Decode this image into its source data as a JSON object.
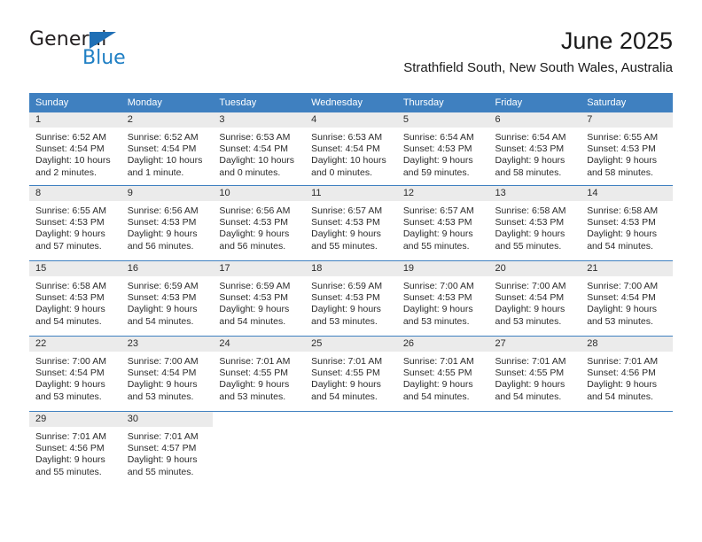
{
  "brand": {
    "name_part1": "General",
    "name_part2": "Blue",
    "accent_color": "#1f7fc4",
    "triangle_color": "#1f6fb5"
  },
  "header": {
    "title": "June 2025",
    "subtitle": "Strathfield South, New South Wales, Australia"
  },
  "calendar": {
    "header_bg": "#3f80c0",
    "daynum_bg": "#ebebeb",
    "weekday_headers": [
      "Sunday",
      "Monday",
      "Tuesday",
      "Wednesday",
      "Thursday",
      "Friday",
      "Saturday"
    ],
    "weeks": [
      {
        "days": [
          {
            "daynum": "1",
            "sunrise": "Sunrise: 6:52 AM",
            "sunset": "Sunset: 4:54 PM",
            "daylight_line1": "Daylight: 10 hours",
            "daylight_line2": "and 2 minutes."
          },
          {
            "daynum": "2",
            "sunrise": "Sunrise: 6:52 AM",
            "sunset": "Sunset: 4:54 PM",
            "daylight_line1": "Daylight: 10 hours",
            "daylight_line2": "and 1 minute."
          },
          {
            "daynum": "3",
            "sunrise": "Sunrise: 6:53 AM",
            "sunset": "Sunset: 4:54 PM",
            "daylight_line1": "Daylight: 10 hours",
            "daylight_line2": "and 0 minutes."
          },
          {
            "daynum": "4",
            "sunrise": "Sunrise: 6:53 AM",
            "sunset": "Sunset: 4:54 PM",
            "daylight_line1": "Daylight: 10 hours",
            "daylight_line2": "and 0 minutes."
          },
          {
            "daynum": "5",
            "sunrise": "Sunrise: 6:54 AM",
            "sunset": "Sunset: 4:53 PM",
            "daylight_line1": "Daylight: 9 hours",
            "daylight_line2": "and 59 minutes."
          },
          {
            "daynum": "6",
            "sunrise": "Sunrise: 6:54 AM",
            "sunset": "Sunset: 4:53 PM",
            "daylight_line1": "Daylight: 9 hours",
            "daylight_line2": "and 58 minutes."
          },
          {
            "daynum": "7",
            "sunrise": "Sunrise: 6:55 AM",
            "sunset": "Sunset: 4:53 PM",
            "daylight_line1": "Daylight: 9 hours",
            "daylight_line2": "and 58 minutes."
          }
        ]
      },
      {
        "days": [
          {
            "daynum": "8",
            "sunrise": "Sunrise: 6:55 AM",
            "sunset": "Sunset: 4:53 PM",
            "daylight_line1": "Daylight: 9 hours",
            "daylight_line2": "and 57 minutes."
          },
          {
            "daynum": "9",
            "sunrise": "Sunrise: 6:56 AM",
            "sunset": "Sunset: 4:53 PM",
            "daylight_line1": "Daylight: 9 hours",
            "daylight_line2": "and 56 minutes."
          },
          {
            "daynum": "10",
            "sunrise": "Sunrise: 6:56 AM",
            "sunset": "Sunset: 4:53 PM",
            "daylight_line1": "Daylight: 9 hours",
            "daylight_line2": "and 56 minutes."
          },
          {
            "daynum": "11",
            "sunrise": "Sunrise: 6:57 AM",
            "sunset": "Sunset: 4:53 PM",
            "daylight_line1": "Daylight: 9 hours",
            "daylight_line2": "and 55 minutes."
          },
          {
            "daynum": "12",
            "sunrise": "Sunrise: 6:57 AM",
            "sunset": "Sunset: 4:53 PM",
            "daylight_line1": "Daylight: 9 hours",
            "daylight_line2": "and 55 minutes."
          },
          {
            "daynum": "13",
            "sunrise": "Sunrise: 6:58 AM",
            "sunset": "Sunset: 4:53 PM",
            "daylight_line1": "Daylight: 9 hours",
            "daylight_line2": "and 55 minutes."
          },
          {
            "daynum": "14",
            "sunrise": "Sunrise: 6:58 AM",
            "sunset": "Sunset: 4:53 PM",
            "daylight_line1": "Daylight: 9 hours",
            "daylight_line2": "and 54 minutes."
          }
        ]
      },
      {
        "days": [
          {
            "daynum": "15",
            "sunrise": "Sunrise: 6:58 AM",
            "sunset": "Sunset: 4:53 PM",
            "daylight_line1": "Daylight: 9 hours",
            "daylight_line2": "and 54 minutes."
          },
          {
            "daynum": "16",
            "sunrise": "Sunrise: 6:59 AM",
            "sunset": "Sunset: 4:53 PM",
            "daylight_line1": "Daylight: 9 hours",
            "daylight_line2": "and 54 minutes."
          },
          {
            "daynum": "17",
            "sunrise": "Sunrise: 6:59 AM",
            "sunset": "Sunset: 4:53 PM",
            "daylight_line1": "Daylight: 9 hours",
            "daylight_line2": "and 54 minutes."
          },
          {
            "daynum": "18",
            "sunrise": "Sunrise: 6:59 AM",
            "sunset": "Sunset: 4:53 PM",
            "daylight_line1": "Daylight: 9 hours",
            "daylight_line2": "and 53 minutes."
          },
          {
            "daynum": "19",
            "sunrise": "Sunrise: 7:00 AM",
            "sunset": "Sunset: 4:53 PM",
            "daylight_line1": "Daylight: 9 hours",
            "daylight_line2": "and 53 minutes."
          },
          {
            "daynum": "20",
            "sunrise": "Sunrise: 7:00 AM",
            "sunset": "Sunset: 4:54 PM",
            "daylight_line1": "Daylight: 9 hours",
            "daylight_line2": "and 53 minutes."
          },
          {
            "daynum": "21",
            "sunrise": "Sunrise: 7:00 AM",
            "sunset": "Sunset: 4:54 PM",
            "daylight_line1": "Daylight: 9 hours",
            "daylight_line2": "and 53 minutes."
          }
        ]
      },
      {
        "days": [
          {
            "daynum": "22",
            "sunrise": "Sunrise: 7:00 AM",
            "sunset": "Sunset: 4:54 PM",
            "daylight_line1": "Daylight: 9 hours",
            "daylight_line2": "and 53 minutes."
          },
          {
            "daynum": "23",
            "sunrise": "Sunrise: 7:00 AM",
            "sunset": "Sunset: 4:54 PM",
            "daylight_line1": "Daylight: 9 hours",
            "daylight_line2": "and 53 minutes."
          },
          {
            "daynum": "24",
            "sunrise": "Sunrise: 7:01 AM",
            "sunset": "Sunset: 4:55 PM",
            "daylight_line1": "Daylight: 9 hours",
            "daylight_line2": "and 53 minutes."
          },
          {
            "daynum": "25",
            "sunrise": "Sunrise: 7:01 AM",
            "sunset": "Sunset: 4:55 PM",
            "daylight_line1": "Daylight: 9 hours",
            "daylight_line2": "and 54 minutes."
          },
          {
            "daynum": "26",
            "sunrise": "Sunrise: 7:01 AM",
            "sunset": "Sunset: 4:55 PM",
            "daylight_line1": "Daylight: 9 hours",
            "daylight_line2": "and 54 minutes."
          },
          {
            "daynum": "27",
            "sunrise": "Sunrise: 7:01 AM",
            "sunset": "Sunset: 4:55 PM",
            "daylight_line1": "Daylight: 9 hours",
            "daylight_line2": "and 54 minutes."
          },
          {
            "daynum": "28",
            "sunrise": "Sunrise: 7:01 AM",
            "sunset": "Sunset: 4:56 PM",
            "daylight_line1": "Daylight: 9 hours",
            "daylight_line2": "and 54 minutes."
          }
        ]
      },
      {
        "days": [
          {
            "daynum": "29",
            "sunrise": "Sunrise: 7:01 AM",
            "sunset": "Sunset: 4:56 PM",
            "daylight_line1": "Daylight: 9 hours",
            "daylight_line2": "and 55 minutes."
          },
          {
            "daynum": "30",
            "sunrise": "Sunrise: 7:01 AM",
            "sunset": "Sunset: 4:57 PM",
            "daylight_line1": "Daylight: 9 hours",
            "daylight_line2": "and 55 minutes."
          },
          {
            "daynum": "",
            "sunrise": "",
            "sunset": "",
            "daylight_line1": "",
            "daylight_line2": ""
          },
          {
            "daynum": "",
            "sunrise": "",
            "sunset": "",
            "daylight_line1": "",
            "daylight_line2": ""
          },
          {
            "daynum": "",
            "sunrise": "",
            "sunset": "",
            "daylight_line1": "",
            "daylight_line2": ""
          },
          {
            "daynum": "",
            "sunrise": "",
            "sunset": "",
            "daylight_line1": "",
            "daylight_line2": ""
          },
          {
            "daynum": "",
            "sunrise": "",
            "sunset": "",
            "daylight_line1": "",
            "daylight_line2": ""
          }
        ]
      }
    ]
  }
}
